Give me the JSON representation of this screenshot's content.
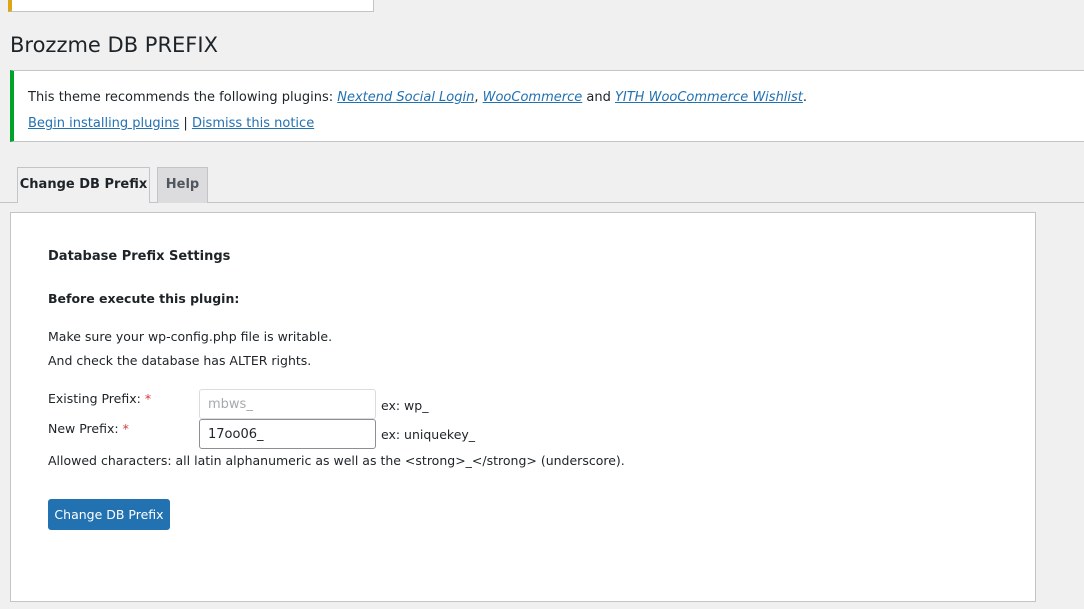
{
  "page": {
    "title": "Brozzme DB PREFIX"
  },
  "notice": {
    "intro": "This theme recommends the following plugins: ",
    "plugins": [
      "Nextend Social Login",
      "WooCommerce",
      "YITH WooCommerce Wishlist"
    ],
    "sep_comma": ", ",
    "sep_and": " and ",
    "end": ".",
    "install_link": "Begin installing plugins",
    "pipe": " | ",
    "dismiss_link": "Dismiss this notice"
  },
  "tabs": [
    {
      "label": "Change DB Prefix",
      "active": true
    },
    {
      "label": "Help",
      "active": false
    }
  ],
  "panel": {
    "section_title": "Database Prefix Settings",
    "before_title": "Before execute this plugin:",
    "line1": "Make sure your wp-config.php file is writable.",
    "line2": "And check the database has ALTER rights.",
    "existing_label": "Existing Prefix: ",
    "new_label": "New Prefix: ",
    "required_mark": "*",
    "existing_value": "mbws_",
    "new_value": "17oo06_",
    "existing_hint": "ex: wp_",
    "new_hint": "ex: uniquekey_",
    "allowed_text": "Allowed characters: all latin alphanumeric as well as the <strong>_</strong> (underscore).",
    "submit_label": "Change DB Prefix"
  },
  "colors": {
    "accent": "#2271b1",
    "notice_border": "#00a32a",
    "required": "#d63638"
  }
}
